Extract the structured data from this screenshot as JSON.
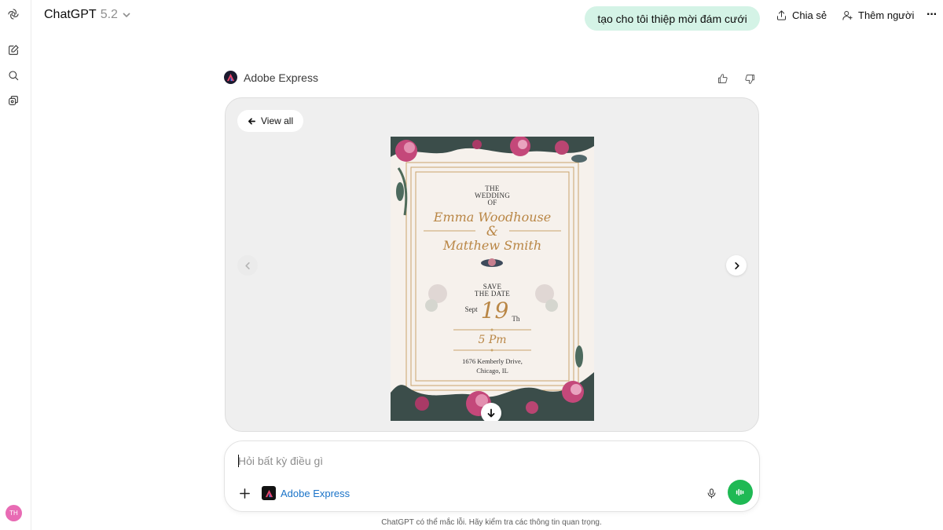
{
  "colors": {
    "user_bubble": "#d4f3e6",
    "send_voice": "#1fb954",
    "link_blue": "#1a73c8",
    "avatar": "#e86bb4",
    "card_bg": "#efefef"
  },
  "rail": {
    "icons": [
      "openai-logo-icon",
      "new-chat-icon",
      "search-icon",
      "library-icon"
    ],
    "avatar_initials": "TH"
  },
  "header": {
    "model_name": "ChatGPT",
    "model_version": "5.2",
    "share_label": "Chia sẻ",
    "add_people_label": "Thêm người",
    "more_label": "···"
  },
  "conversation": {
    "user_message": "tạo cho tôi thiệp mời đám cưới",
    "app_name": "Adobe Express"
  },
  "card": {
    "view_all_label": "View all",
    "invitation": {
      "line1": "THE",
      "line2": "WEDDING",
      "line3": "OF",
      "name1": "Emma Woodhouse",
      "amp": "&",
      "name2": "Matthew Smith",
      "save1": "SAVE",
      "save2": "THE DATE",
      "month": "Sept",
      "day": "19",
      "suffix": "Th",
      "time": "5 Pm",
      "address1": "1676 Kemberly Drive,",
      "address2": "Chicago, IL"
    }
  },
  "composer": {
    "placeholder": "Hỏi bất kỳ điều gì",
    "tool_label": "Adobe Express"
  },
  "footer": {
    "disclaimer": "ChatGPT có thể mắc lỗi. Hãy kiểm tra các thông tin quan trọng."
  }
}
